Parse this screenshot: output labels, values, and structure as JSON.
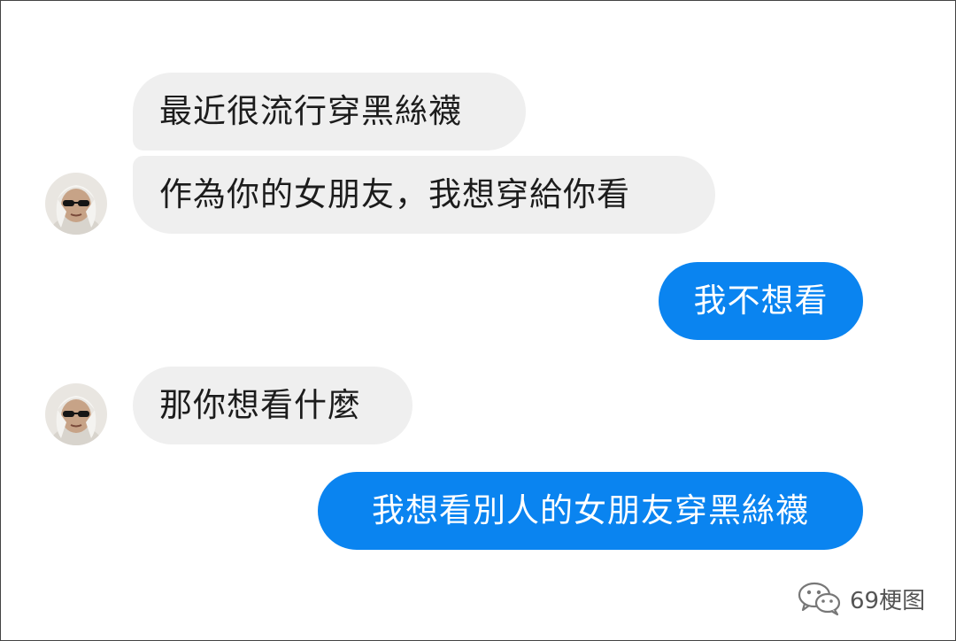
{
  "conversation": {
    "messages": [
      {
        "side": "incoming",
        "text": "最近很流行穿黑絲襪"
      },
      {
        "side": "incoming",
        "text": "作為你的女朋友，我想穿給你看"
      },
      {
        "side": "outgoing",
        "text": "我不想看"
      },
      {
        "side": "incoming",
        "text": "那你想看什麼"
      },
      {
        "side": "outgoing",
        "text": "我想看別人的女朋友穿黑絲襪"
      }
    ]
  },
  "avatar": {
    "icon": "user-avatar-icon"
  },
  "watermark": {
    "icon": "wechat-icon",
    "text": "69梗图"
  },
  "colors": {
    "incoming_bubble": "#efefef",
    "outgoing_bubble": "#0a84f0",
    "incoming_text": "#1c1c1c",
    "outgoing_text": "#ffffff"
  }
}
